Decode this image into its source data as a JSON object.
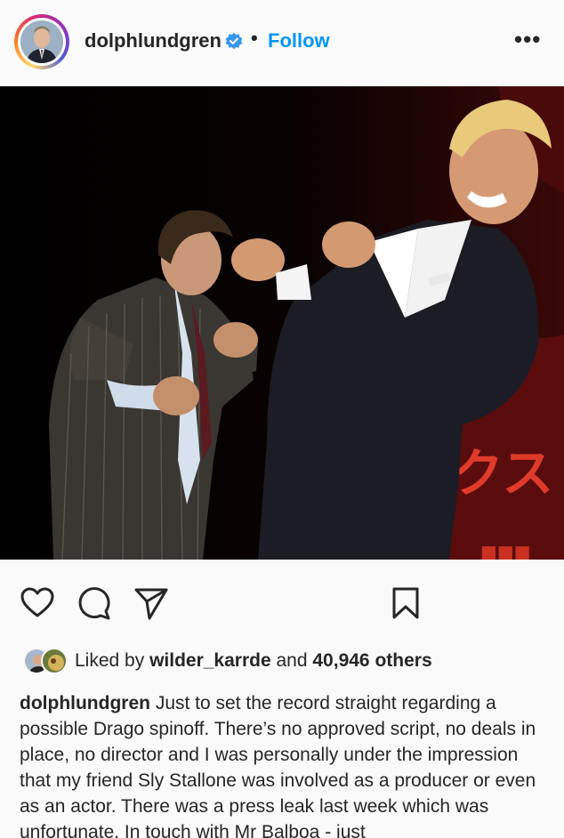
{
  "header": {
    "username": "dolphlundgren",
    "separator": "•",
    "follow_label": "Follow",
    "more_label": "•••"
  },
  "icons": {
    "verified": "verified-badge-icon",
    "like": "heart-icon",
    "comment": "comment-icon",
    "share": "send-icon",
    "save": "bookmark-icon"
  },
  "likes": {
    "prefix": "Liked by",
    "user": "wilder_karrde",
    "joiner": "and",
    "count": "40,946 others"
  },
  "caption": {
    "username": "dolphlundgren",
    "text": "Just to set the record straight regarding a possible Drago spinoff. There’s no approved script, no deals in place, no director and I was personally under the impression that my friend Sly Stallone was involved as a producer or even as an actor. There was a press leak last week which was unfortunate. In touch with Mr Balboa - just"
  },
  "photo": {
    "poster_text": "クス"
  },
  "colors": {
    "follow": "#0095f6",
    "verified": "#3897f0",
    "text": "#262626",
    "background": "#fafafa"
  }
}
